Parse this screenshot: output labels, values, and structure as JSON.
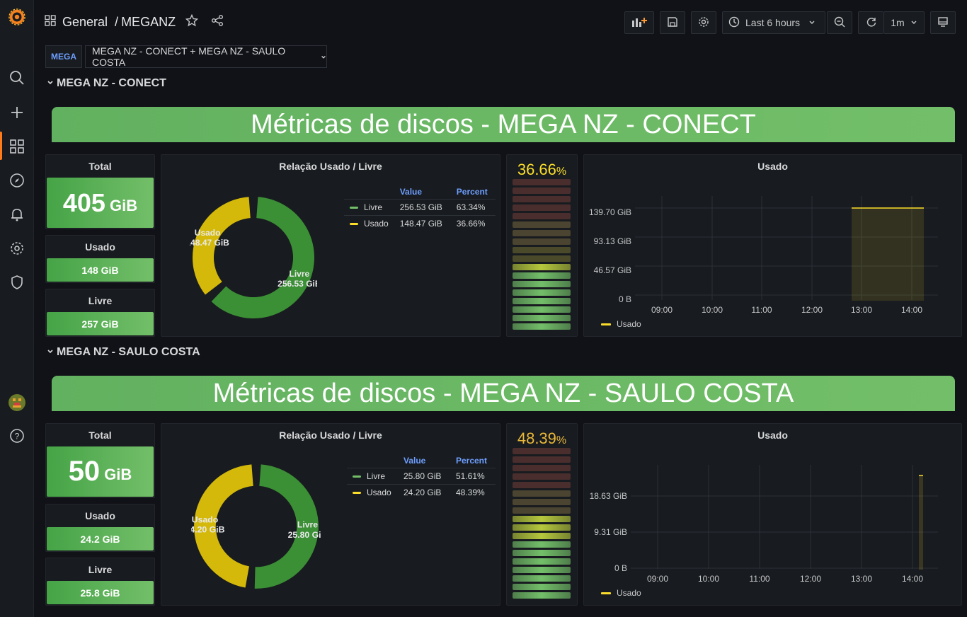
{
  "header": {
    "breadcrumb_folder": "General",
    "breadcrumb_sep": "/",
    "dashboard_title": "MEGANZ",
    "time_range": "Last 6 hours",
    "refresh_interval": "1m"
  },
  "variables": {
    "label": "MEGA",
    "value": "MEGA NZ - CONECT + MEGA NZ - SAULO COSTA"
  },
  "colors": {
    "green": "#73bf69",
    "yellow": "#fade2a",
    "donut_yellow": "#d4b90a",
    "donut_green": "#3b8f35",
    "accent_blue": "#6e9fff",
    "active_orange": "#ff7a1a"
  },
  "icons": {
    "sidebar": [
      "grafana-logo",
      "search-icon",
      "plus-icon",
      "dashboards-icon",
      "explore-icon",
      "alert-bell-icon",
      "gear-icon",
      "shield-icon",
      "avatar",
      "help-icon"
    ],
    "topbar": [
      "add-panel-icon",
      "save-icon",
      "settings-icon",
      "clock-icon",
      "zoom-out-icon",
      "refresh-icon",
      "tv-mode-icon"
    ]
  },
  "rows": [
    {
      "row_title": "MEGA NZ - CONECT",
      "banner": "Métricas de discos - MEGA NZ - CONECT",
      "stat_total": {
        "title": "Total",
        "value": "405",
        "unit": "GiB"
      },
      "stat_used": {
        "title": "Usado",
        "value": "148 GiB"
      },
      "stat_free": {
        "title": "Livre",
        "value": "257 GiB"
      },
      "pie": {
        "title": "Relação Usado / Livre",
        "col_value": "Value",
        "col_percent": "Percent",
        "entries": [
          {
            "name": "Livre",
            "value": "256.53 GiB",
            "percent": "63.34%",
            "fraction": 0.6334
          },
          {
            "name": "Usado",
            "value": "148.47 GiB",
            "percent": "36.66%",
            "fraction": 0.3666
          }
        ]
      },
      "gauge": {
        "value": "36.66",
        "unit": "%",
        "fraction": 0.3666
      },
      "graph": {
        "title": "Usado",
        "yticks": [
          "139.70 GiB",
          "93.13 GiB",
          "46.57 GiB",
          "0 B"
        ],
        "xticks": [
          "09:00",
          "10:00",
          "11:00",
          "12:00",
          "13:00",
          "14:00"
        ],
        "legend": "Usado"
      }
    },
    {
      "row_title": "MEGA NZ - SAULO COSTA",
      "banner": "Métricas de discos - MEGA NZ - SAULO COSTA",
      "stat_total": {
        "title": "Total",
        "value": "50",
        "unit": "GiB"
      },
      "stat_used": {
        "title": "Usado",
        "value": "24.2 GiB"
      },
      "stat_free": {
        "title": "Livre",
        "value": "25.8 GiB"
      },
      "pie": {
        "title": "Relação Usado / Livre",
        "col_value": "Value",
        "col_percent": "Percent",
        "entries": [
          {
            "name": "Livre",
            "value": "25.80 GiB",
            "percent": "51.61%",
            "fraction": 0.5161
          },
          {
            "name": "Usado",
            "value": "24.20 GiB",
            "percent": "48.39%",
            "fraction": 0.4839
          }
        ]
      },
      "gauge": {
        "value": "48.39",
        "unit": "%",
        "fraction": 0.4839
      },
      "graph": {
        "title": "Usado",
        "yticks": [
          "18.63 GiB",
          "9.31 GiB",
          "0 B"
        ],
        "xticks": [
          "09:00",
          "10:00",
          "11:00",
          "12:00",
          "13:00",
          "14:00"
        ],
        "legend": "Usado"
      }
    }
  ]
}
